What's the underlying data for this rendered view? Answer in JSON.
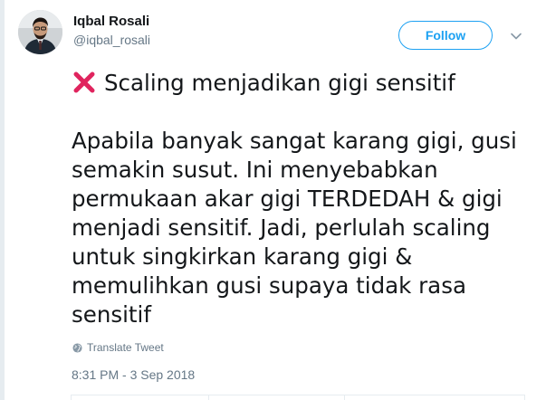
{
  "author": {
    "display_name": "Iqbal Rosali",
    "username": "@iqbal_rosali",
    "avatar_icon": "avatar-photo"
  },
  "follow_label": "Follow",
  "tweet": {
    "headline_icon": "cross-mark-icon",
    "headline": "Scaling menjadikan gigi sensitif",
    "body_lines": [
      "Apabila banyak sangat karang gigi, gusi",
      "semakin susut. Ini menyebabkan",
      "permukaan akar gigi TERDEDAH & gigi",
      "menjadi sensitif. Jadi, perlulah scaling",
      "untuk singkirkan karang gigi &",
      "memulihkan gusi supaya tidak rasa",
      "sensitif"
    ]
  },
  "translate_label": "Translate Tweet",
  "timestamp": "8:31 PM - 3 Sep 2018",
  "colors": {
    "accent": "#1da1f2",
    "secondary_text": "#657786",
    "cross": "#e0245e"
  }
}
